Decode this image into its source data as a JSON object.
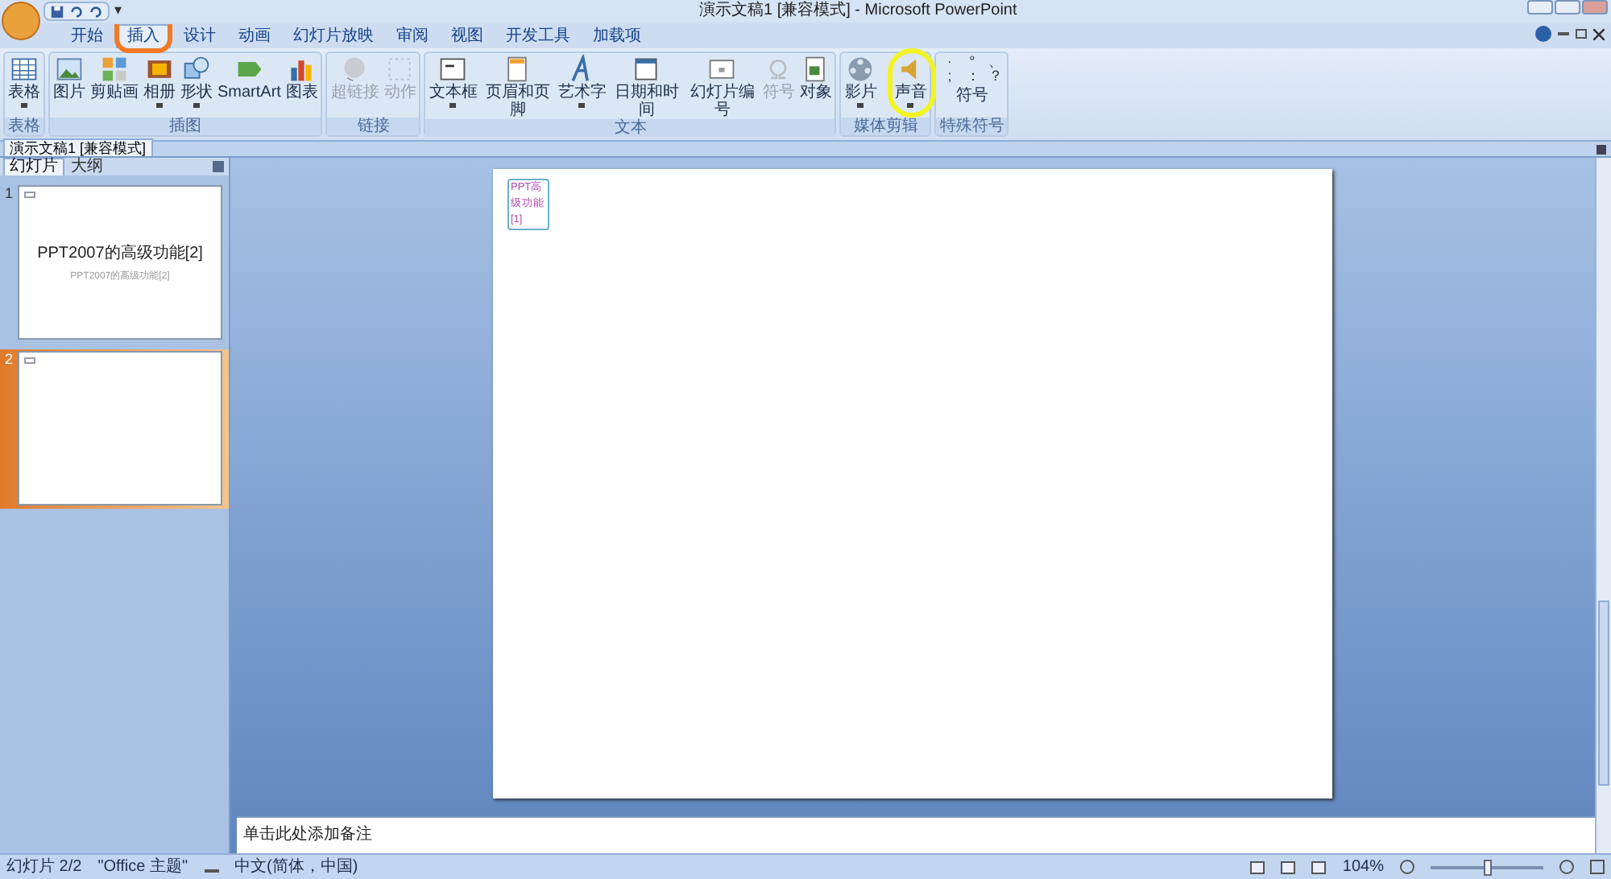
{
  "window": {
    "title": "演示文稿1 [兼容模式] - Microsoft PowerPoint"
  },
  "quick_access": [
    "▾"
  ],
  "tabs": [
    {
      "label": "开始",
      "selected": false
    },
    {
      "label": "插入",
      "selected": true
    },
    {
      "label": "设计",
      "selected": false
    },
    {
      "label": "动画",
      "selected": false
    },
    {
      "label": "幻灯片放映",
      "selected": false
    },
    {
      "label": "审阅",
      "selected": false
    },
    {
      "label": "视图",
      "selected": false
    },
    {
      "label": "开发工具",
      "selected": false
    },
    {
      "label": "加载项",
      "selected": false
    }
  ],
  "ribbon_groups": [
    {
      "label": "表格",
      "buttons": [
        {
          "label": "表格",
          "kind": "table",
          "disabled": false,
          "dropdown": true
        }
      ]
    },
    {
      "label": "插图",
      "buttons": [
        {
          "label": "图片",
          "kind": "picture",
          "disabled": false,
          "dropdown": false
        },
        {
          "label": "剪贴画",
          "kind": "clipart",
          "disabled": false,
          "dropdown": false
        },
        {
          "label": "相册",
          "kind": "album",
          "disabled": false,
          "dropdown": true
        },
        {
          "label": "形状",
          "kind": "shapes",
          "disabled": false,
          "dropdown": true
        },
        {
          "label": "SmartArt",
          "kind": "smartart",
          "disabled": false,
          "dropdown": false
        },
        {
          "label": "图表",
          "kind": "chart",
          "disabled": false,
          "dropdown": false
        }
      ]
    },
    {
      "label": "链接",
      "buttons": [
        {
          "label": "超链接",
          "kind": "globe",
          "disabled": true,
          "dropdown": false
        },
        {
          "label": "动作",
          "kind": "action",
          "disabled": true,
          "dropdown": false
        }
      ]
    },
    {
      "label": "文本",
      "buttons": [
        {
          "label": "文本框",
          "kind": "textbox",
          "disabled": false,
          "dropdown": true
        },
        {
          "label": "页眉和页脚",
          "kind": "header",
          "disabled": false,
          "dropdown": false
        },
        {
          "label": "艺术字",
          "kind": "wordart",
          "disabled": false,
          "dropdown": true
        },
        {
          "label": "日期和时间",
          "kind": "date",
          "disabled": false,
          "dropdown": false
        },
        {
          "label": "幻灯片编号",
          "kind": "slidenum",
          "disabled": false,
          "dropdown": false
        },
        {
          "label": "符号",
          "kind": "omega",
          "disabled": true,
          "dropdown": false
        },
        {
          "label": "对象",
          "kind": "object",
          "disabled": false,
          "dropdown": false
        }
      ]
    },
    {
      "label": "媒体剪辑",
      "buttons": [
        {
          "label": "影片",
          "kind": "film",
          "disabled": false,
          "dropdown": true
        },
        {
          "label": "声音",
          "kind": "sound",
          "disabled": false,
          "dropdown": true
        }
      ]
    },
    {
      "label": "特殊符号",
      "symbols": [
        "·",
        "°",
        "、",
        ";",
        "：",
        "？"
      ],
      "menu": "符号"
    }
  ],
  "document_tab": {
    "label": "演示文稿1 [兼容模式]"
  },
  "panel_tabs": [
    {
      "label": "幻灯片",
      "selected": true
    },
    {
      "label": "大纲",
      "selected": false
    }
  ],
  "slides": [
    {
      "number": "1",
      "title": "PPT2007的高级功能[2]",
      "subtitle": "PPT2007的高级功能[2]",
      "selected": false
    },
    {
      "number": "2",
      "selected": true
    }
  ],
  "current_slide": {
    "text_box": "PPT高级功能[1]"
  },
  "notes": {
    "placeholder": "单击此处添加备注"
  },
  "status_bar": {
    "slide": "幻灯片 2/2",
    "theme": "\"Office 主题\"",
    "language": "中文(简体，中国)",
    "zoom": "104%",
    "zoom_level": {
      "level": 0.5
    }
  },
  "annotations": [
    {
      "kind": "circle"
    },
    {
      "kind": "ellipse"
    }
  ]
}
